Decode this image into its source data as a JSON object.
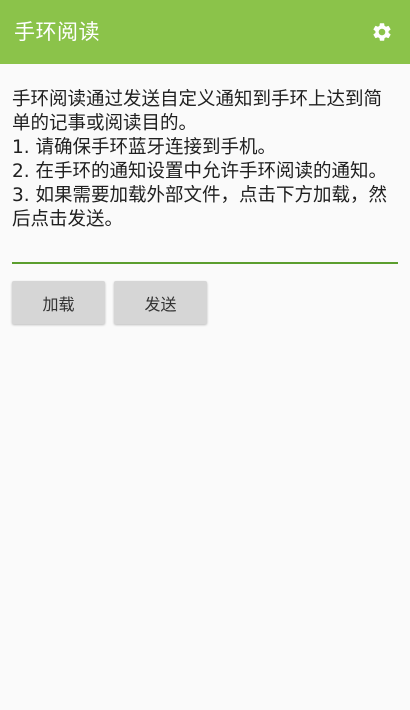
{
  "toolbar": {
    "title": "手环阅读",
    "settings_icon": "gear-icon",
    "background_color": "#8bc34a",
    "title_color": "#ffffff"
  },
  "note": {
    "text": "手环阅读通过发送自定义通知到手环上达到简单的记事或阅读目的。\n1. 请确保手环蓝牙连接到手机。\n2. 在手环的通知设置中允许手环阅读的通知。\n3. 如果需要加载外部文件，点击下方加载，然后点击发送。",
    "underline_color": "#5b9e2e"
  },
  "buttons": {
    "load_label": "加载",
    "send_label": "发送"
  }
}
